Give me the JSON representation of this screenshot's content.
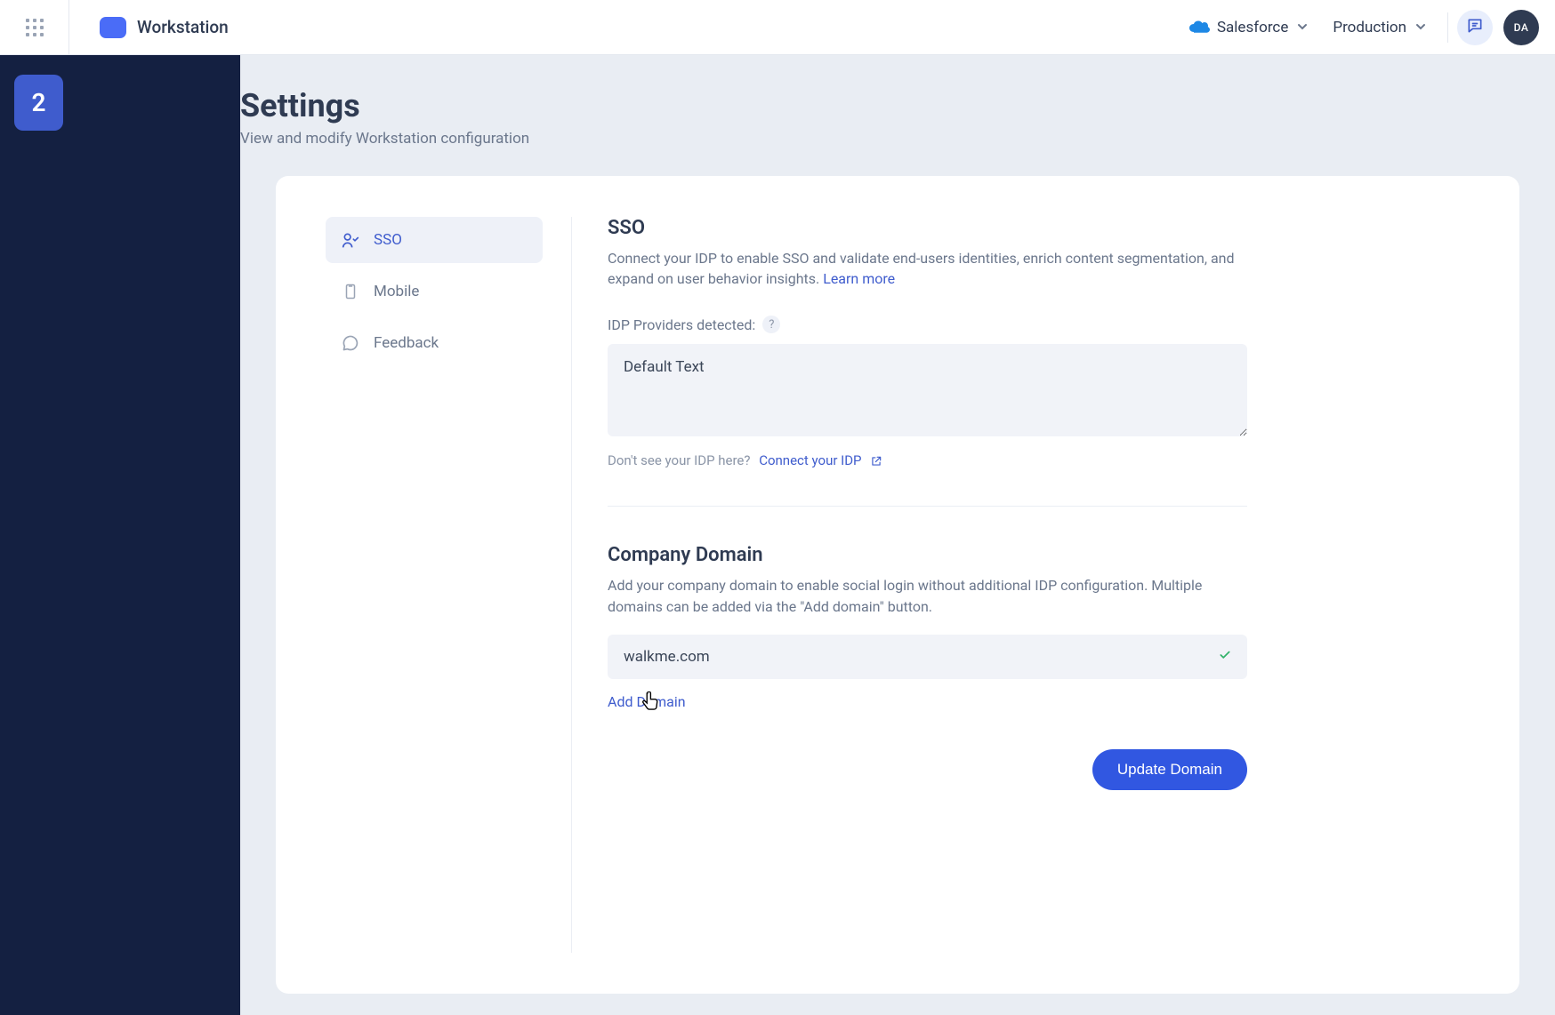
{
  "brand": {
    "name": "Workstation"
  },
  "topbar": {
    "system_selector": "Salesforce",
    "env_selector": "Production",
    "avatar_initials": "DA"
  },
  "leftnav": {
    "tile_label": "2"
  },
  "page": {
    "title": "Settings",
    "subtitle": "View and modify Workstation configuration"
  },
  "settings_nav": {
    "items": [
      {
        "id": "sso",
        "label": "SSO",
        "active": true
      },
      {
        "id": "mobile",
        "label": "Mobile",
        "active": false
      },
      {
        "id": "feedback",
        "label": "Feedback",
        "active": false
      }
    ]
  },
  "sso": {
    "heading": "SSO",
    "description": "Connect your IDP to enable SSO and validate end-users identities, enrich content segmentation, and expand on user behavior insights.",
    "learn_more": "Learn more",
    "idp_label": "IDP Providers detected:",
    "textarea_value": "Default Text",
    "hint_prefix": "Don't see your IDP here?",
    "connect_idp": "Connect your IDP"
  },
  "domain": {
    "heading": "Company Domain",
    "description": "Add your company domain to enable social login without additional IDP configuration. Multiple domains can be added via the \"Add domain\" button.",
    "value": "walkme.com",
    "add_label": "Add Domain",
    "update_button": "Update Domain"
  }
}
